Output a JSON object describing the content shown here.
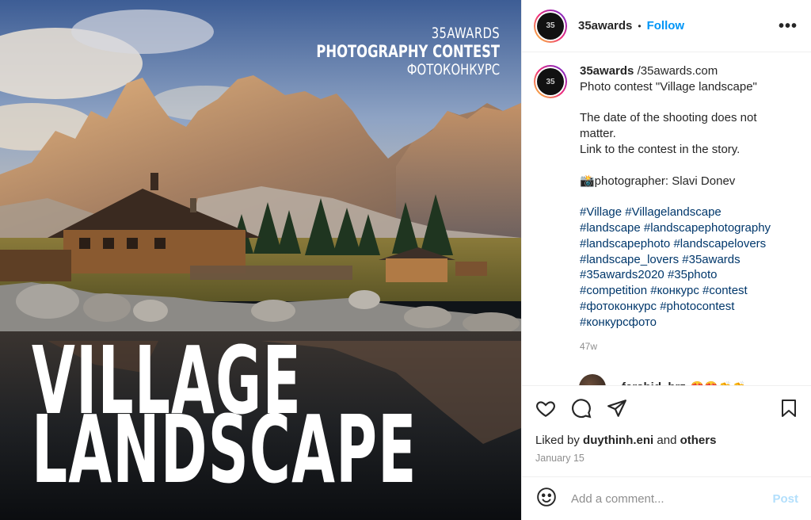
{
  "photo": {
    "brand_line1": "35AWARDS",
    "brand_line2": "PHOTOGRAPHY CONTEST",
    "brand_line3": "ФОТОКОНКУРС",
    "headline_line1": "VILLAGE",
    "headline_line2": "LANDSCAPE"
  },
  "header": {
    "avatar_text": "35",
    "username": "35awards",
    "separator": "•",
    "follow_label": "Follow",
    "more_label": "•••"
  },
  "caption": {
    "avatar_text": "35",
    "username": "35awards",
    "lines": [
      "/35awards.com",
      "Photo contest \"Village landscape\"",
      "",
      "The date of the shooting does not",
      "matter.",
      "Link to the contest in the story.",
      "",
      "📸photographer: Slavi Donev",
      ""
    ],
    "hashtag_lines": [
      [
        "#Village",
        "#Villagelandscape"
      ],
      [
        "#landscape",
        "#landscapephotography"
      ],
      [
        "#landscapephoto",
        "#landscapelovers"
      ],
      [
        "#landscape_lovers",
        "#35awards"
      ],
      [
        "#35awards2020",
        "#35photo"
      ],
      [
        "#competition",
        "#конкурс",
        "#contest"
      ],
      [
        "#фотоконкурс",
        "#photocontest"
      ],
      [
        "#конкурсфото"
      ]
    ],
    "time": "47w"
  },
  "comment": {
    "username": "farshid_brz",
    "emoji": "😍😍👏👏"
  },
  "actions": {
    "icons": [
      "heart-icon",
      "comment-icon",
      "share-icon",
      "bookmark-icon"
    ],
    "liked_by_prefix": "Liked by ",
    "liked_by_user": "duythinh.eni",
    "liked_by_and": " and ",
    "liked_by_others": "others",
    "date": "January 15"
  },
  "add_comment": {
    "emoji_icon": "smiley-icon",
    "placeholder": "Add a comment...",
    "post_label": "Post"
  },
  "colors": {
    "link_blue": "#0095f6",
    "hashtag": "#00376b",
    "muted": "#8e8e8e",
    "post_disabled": "#b2dffc"
  }
}
